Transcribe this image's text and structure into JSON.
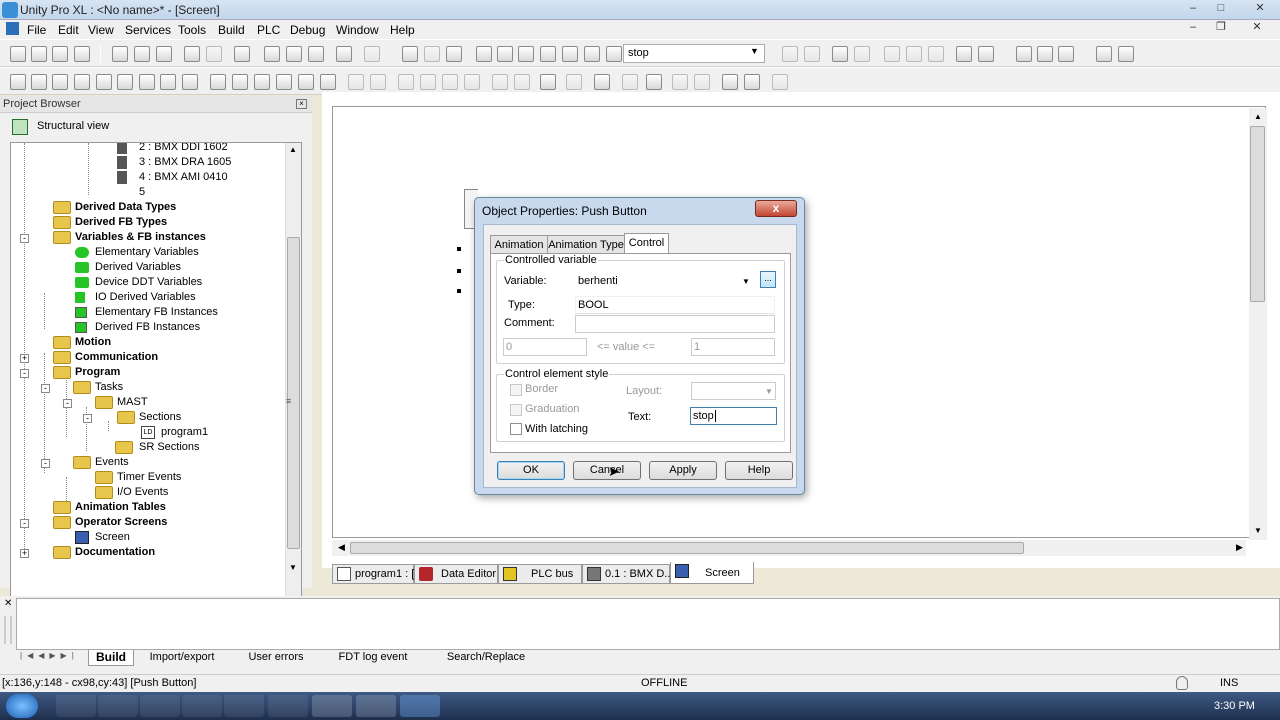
{
  "window": {
    "title": "Unity Pro XL : <No name>* - [Screen]"
  },
  "menu": [
    "File",
    "Edit",
    "View",
    "Services",
    "Tools",
    "Build",
    "PLC",
    "Debug",
    "Window",
    "Help"
  ],
  "toolbar": {
    "search_value": "stop"
  },
  "project_browser": {
    "title": "Project Browser",
    "view": "Structural view",
    "items": [
      {
        "label": "2 : BMX DDI 1602",
        "bold": false
      },
      {
        "label": "3 : BMX DRA 1605",
        "bold": false
      },
      {
        "label": "4 : BMX AMI 0410",
        "bold": false
      },
      {
        "label": "5",
        "bold": false
      },
      {
        "label": "Derived Data Types",
        "bold": true
      },
      {
        "label": "Derived FB Types",
        "bold": true
      },
      {
        "label": "Variables & FB instances",
        "bold": true
      },
      {
        "label": "Elementary Variables",
        "bold": false
      },
      {
        "label": "Derived Variables",
        "bold": false
      },
      {
        "label": "Device DDT Variables",
        "bold": false
      },
      {
        "label": "IO Derived Variables",
        "bold": false
      },
      {
        "label": "Elementary FB Instances",
        "bold": false
      },
      {
        "label": "Derived FB Instances",
        "bold": false
      },
      {
        "label": "Motion",
        "bold": true
      },
      {
        "label": "Communication",
        "bold": true
      },
      {
        "label": "Program",
        "bold": true
      },
      {
        "label": "Tasks",
        "bold": false
      },
      {
        "label": "MAST",
        "bold": false
      },
      {
        "label": "Sections",
        "bold": false
      },
      {
        "label": "program1",
        "bold": false
      },
      {
        "label": "SR Sections",
        "bold": false
      },
      {
        "label": "Events",
        "bold": false
      },
      {
        "label": "Timer Events",
        "bold": false
      },
      {
        "label": "I/O Events",
        "bold": false
      },
      {
        "label": "Animation Tables",
        "bold": true
      },
      {
        "label": "Operator Screens",
        "bold": true
      },
      {
        "label": "Screen",
        "bold": false
      },
      {
        "label": "Documentation",
        "bold": true
      }
    ]
  },
  "dialog": {
    "title": "Object Properties: Push Button",
    "close": "x",
    "tabs": [
      "Animation",
      "Animation Type",
      "Control"
    ],
    "active_tab": "Control",
    "controlled_variable": {
      "group_title": "Controlled variable",
      "variable_label": "Variable:",
      "variable_value": "berhenti",
      "browse_label": "...",
      "type_label": "Type:",
      "type_value": "BOOL",
      "comment_label": "Comment:",
      "comment_value": "",
      "min_value": "0",
      "range_text": "<= value <=",
      "max_value": "1"
    },
    "style": {
      "group_title": "Control element style",
      "border_label": "Border",
      "graduation_label": "Graduation",
      "latching_label": "With latching",
      "layout_label": "Layout:",
      "text_label": "Text:",
      "text_value": "stop"
    },
    "buttons": {
      "ok": "OK",
      "cancel": "Cancel",
      "apply": "Apply",
      "help": "Help"
    }
  },
  "doc_tabs": [
    {
      "label": "program1 : [..."
    },
    {
      "label": "Data Editor"
    },
    {
      "label": "PLC bus"
    },
    {
      "label": "0.1 : BMX D..."
    },
    {
      "label": "Screen"
    }
  ],
  "output_tabs": [
    "Build",
    "Import/export",
    "User errors",
    "FDT log event",
    "Search/Replace"
  ],
  "status": {
    "coords": "[x:136,y:148 - cx98,cy:43] [Push Button]",
    "mode": "OFFLINE",
    "ins": "INS"
  },
  "taskbar": {
    "clock": "3:30 PM"
  },
  "colors": {
    "accent": "#3c7fb1",
    "folder": "#e8c64c",
    "taskbar": "#1e2f4d"
  }
}
